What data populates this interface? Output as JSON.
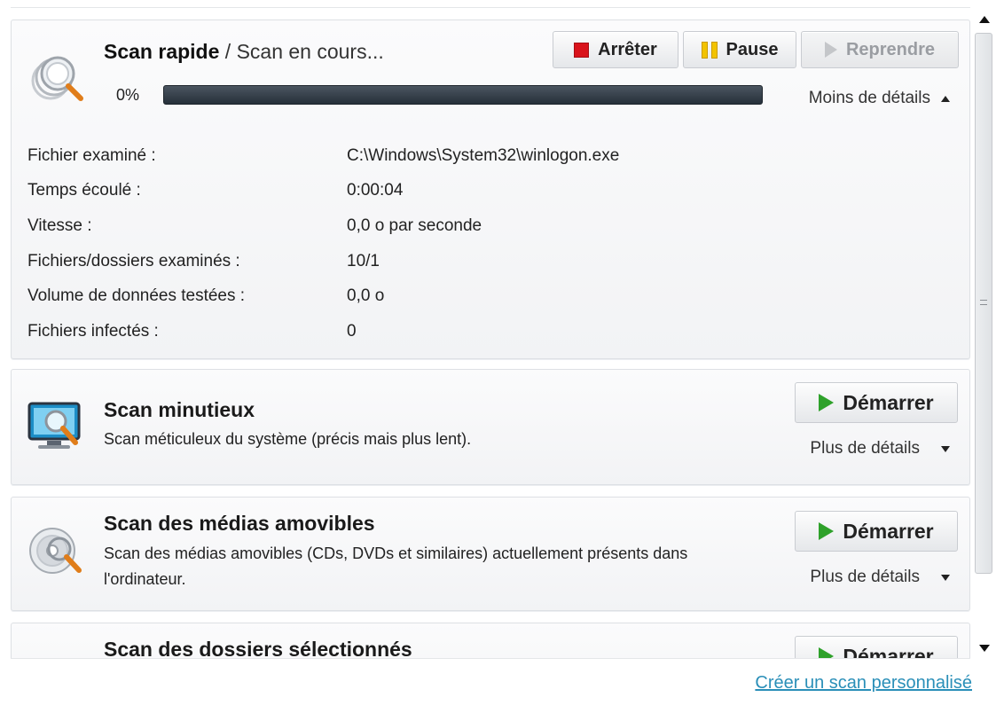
{
  "active_scan": {
    "title": "Scan rapide",
    "status_separator": " / ",
    "status": "Scan en cours...",
    "buttons": {
      "stop": "Arrêter",
      "pause": "Pause",
      "resume": "Reprendre"
    },
    "progress_text": "0%",
    "progress_fraction": 0,
    "details_toggle": "Moins de détails",
    "details": [
      {
        "label": "Fichier examiné :",
        "value": "C:\\Windows\\System32\\winlogon.exe"
      },
      {
        "label": "Temps écoulé :",
        "value": "0:00:04"
      },
      {
        "label": "Vitesse :",
        "value": "0,0 o par seconde"
      },
      {
        "label": "Fichiers/dossiers examinés :",
        "value": "10/1"
      },
      {
        "label": "Volume de données testées :",
        "value": "0,0 o"
      },
      {
        "label": "Fichiers infectés :",
        "value": "0"
      }
    ]
  },
  "scans": [
    {
      "title": "Scan minutieux",
      "description": "Scan méticuleux du système (précis mais plus lent).",
      "button": "Démarrer",
      "details_toggle": "Plus de détails"
    },
    {
      "title": "Scan des médias amovibles",
      "description": "Scan des médias amovibles (CDs, DVDs et similaires) actuellement présents dans l'ordinateur.",
      "button": "Démarrer",
      "details_toggle": "Plus de détails"
    },
    {
      "title": "Scan des dossiers sélectionnés",
      "button": "Démarrer"
    }
  ],
  "footer": {
    "custom_scan_link": "Créer un scan personnalisé"
  },
  "icons": {
    "quick_scan": "quick-scan-icon",
    "full_scan": "monitor-magnifier-icon",
    "removable_scan": "disc-magnifier-icon",
    "folder_scan": "folder-icon"
  },
  "colors": {
    "stop": "#d9131b",
    "pause": "#f2c300",
    "play": "#2ea12a",
    "link": "#2a8fb8",
    "progress_bar": "#26303a"
  }
}
